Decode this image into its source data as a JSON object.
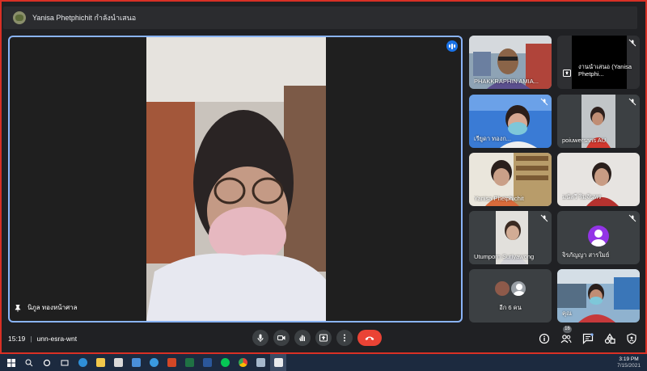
{
  "topbar": {
    "presenting_text": "Yanisa Phetphichit กำลังนำเสนอ"
  },
  "main": {
    "name": "นิภูล ทองหน้าศาล"
  },
  "tiles": [
    {
      "name": "PHAKKRAPHIN AMIA...",
      "muted": false
    },
    {
      "name": "งานนำเสนอ (Yanisa Phetphi...",
      "muted": true
    },
    {
      "name": "เรียูดา ทองก...",
      "muted": true
    },
    {
      "name": "poiuwersans AU",
      "muted": true
    },
    {
      "name": "Yanisa Phetphichit",
      "muted": false
    },
    {
      "name": "มนัสวี ริมจันทร",
      "muted": false
    },
    {
      "name": "Utumporn Suriyawong",
      "muted": true
    },
    {
      "name": "จิรภัญญา สารใมย์",
      "muted": true
    },
    {
      "name": "อีก 6 คน",
      "muted": false
    },
    {
      "name": "คุณ",
      "muted": false
    }
  ],
  "bottombar": {
    "time": "15:19",
    "meeting_code": "unn-esra-wnt",
    "participants_count": "16"
  },
  "taskbar": {
    "time": "3:19 PM",
    "date": "7/15/2021"
  },
  "colors": {
    "accent": "#8ab4f8",
    "hangup": "#ea4335",
    "frame": "#d93025",
    "avatar": "#9334e6"
  }
}
